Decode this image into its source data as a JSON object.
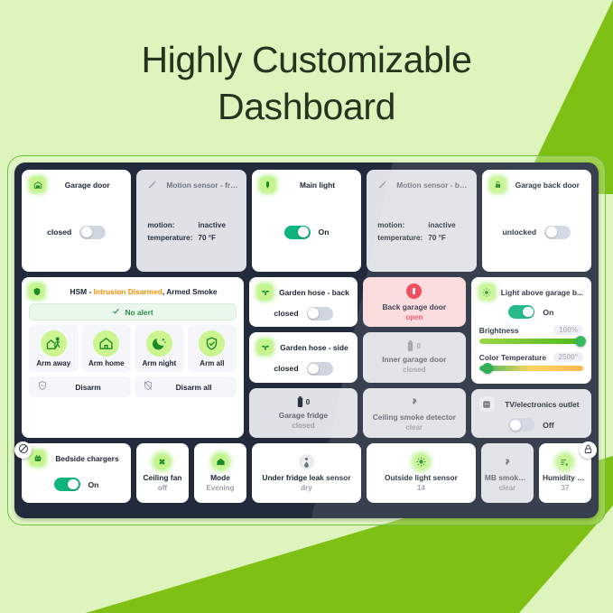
{
  "page": {
    "headline_line1": "Highly Customizable",
    "headline_line2": "Dashboard",
    "background_color": "#ddf5bd",
    "band_color": "#7ec013",
    "frame_border_color": "#6fbe3c",
    "tablet_color": "#222b3b"
  },
  "row1": [
    {
      "name": "Garage door",
      "icon": "garage-door-icon",
      "badge": "green",
      "state": "closed",
      "toggle": "off",
      "style": "white"
    },
    {
      "name": "Motion sensor - front",
      "icon": "motion-sensor-icon",
      "badge": "muted",
      "style": "gray",
      "readings": [
        {
          "key": "motion:",
          "value": "inactive"
        },
        {
          "key": "temperature:",
          "value": "70 °F"
        }
      ]
    },
    {
      "name": "Main light",
      "icon": "light-bulb-icon",
      "badge": "green",
      "state": "On",
      "toggle": "on",
      "style": "white"
    },
    {
      "name": "Motion sensor - back",
      "icon": "motion-sensor-icon",
      "badge": "muted",
      "style": "gray",
      "readings": [
        {
          "key": "motion:",
          "value": "inactive"
        },
        {
          "key": "temperature:",
          "value": "70 °F"
        }
      ]
    },
    {
      "name": "Garage back door",
      "icon": "lock-open-icon",
      "badge": "green",
      "state": "unlocked",
      "toggle": "off",
      "style": "white"
    }
  ],
  "hsm": {
    "icon": "shield-home-icon",
    "title_prefix": "HSM - ",
    "title_warn": "Intrusion Disarmed",
    "title_suffix": ", Armed Smoke",
    "alert_icon": "check-icon",
    "alert_text": "No alert",
    "arm_buttons": [
      {
        "label": "Arm away",
        "icon": "person-leaving-house-icon"
      },
      {
        "label": "Arm home",
        "icon": "house-icon"
      },
      {
        "label": "Arm night",
        "icon": "moon-stars-icon"
      },
      {
        "label": "Arm all",
        "icon": "shield-check-icon"
      }
    ],
    "disarm_buttons": [
      {
        "label": "Disarm",
        "icon": "shield-minus-icon"
      },
      {
        "label": "Disarm all",
        "icon": "shield-off-icon"
      }
    ]
  },
  "col_mid": [
    {
      "name": "Garden hose - back",
      "icon": "valve-icon",
      "badge": "green",
      "state": "closed",
      "toggle": "off",
      "style": "white"
    },
    {
      "name": "Garden hose - side",
      "icon": "valve-icon",
      "badge": "green",
      "state": "closed",
      "toggle": "off",
      "style": "white"
    },
    {
      "name": "Garage fridge",
      "icon": "battery-icon",
      "battery": "0",
      "value": "closed",
      "style": "gray"
    }
  ],
  "col_mid2": [
    {
      "name": "Back garage door",
      "icon": "door-open-icon",
      "value": "open",
      "style": "alert"
    },
    {
      "name": "Inner garage door",
      "icon": "battery-icon",
      "battery": "0",
      "value": "closed",
      "style": "gray"
    },
    {
      "name": "Ceiling smoke detector",
      "icon": "smoke-detector-icon",
      "value": "clear",
      "style": "gray"
    }
  ],
  "light_tile": {
    "name": "Light above garage b...",
    "icon": "light-sun-icon",
    "state": "On",
    "toggle": "on",
    "controls": [
      {
        "label": "Brightness",
        "value": "100%",
        "knob_pct": 97,
        "track": "bright"
      },
      {
        "label": "Color Temperature",
        "value": "2500°",
        "knob_pct": 8,
        "track": "temp"
      }
    ]
  },
  "outlet_tile": {
    "name": "TV/electronics outlet",
    "icon": "outlet-icon",
    "state": "Off",
    "toggle": "off"
  },
  "row_bottom": [
    {
      "name": "Bedside chargers",
      "icon": "plug-icon",
      "badge": "green",
      "state": "On",
      "toggle": "on",
      "style": "white"
    },
    {
      "name": "Ceiling fan",
      "icon": "fan-icon",
      "value": "off",
      "style": "white",
      "glow": true
    },
    {
      "name": "Mode",
      "icon": "house-icon",
      "value": "Evening",
      "style": "white",
      "glow": true
    },
    {
      "name": "Under fridge leak sensor",
      "icon": "water-drop-icon",
      "value": "dry",
      "style": "white",
      "glow": false
    },
    {
      "name": "Outside light sensor",
      "icon": "sun-icon",
      "value": "14",
      "style": "white",
      "glow": true
    },
    {
      "name": "MB smoke d...",
      "icon": "smoke-detector-icon",
      "value": "clear",
      "style": "gray",
      "glow": false
    },
    {
      "name": "Humidity se...",
      "icon": "humidity-icon",
      "value": "37",
      "style": "white",
      "glow": true
    }
  ],
  "handles": {
    "left_icon": "no-entry-icon",
    "right_icon": "lock-icon"
  }
}
